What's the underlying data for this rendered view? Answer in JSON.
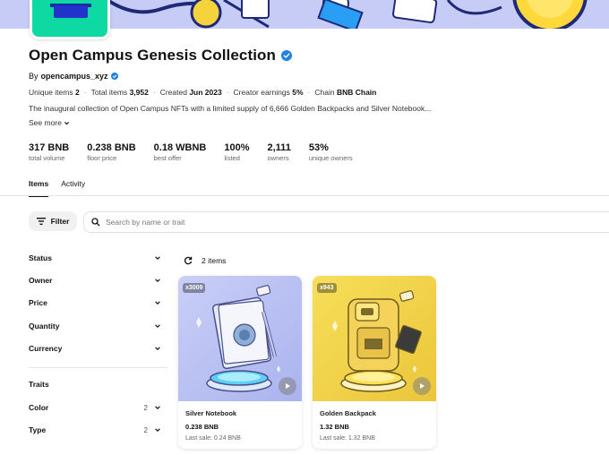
{
  "collection": {
    "title": "Open Campus Genesis Collection",
    "by_prefix": "By",
    "creator": "opencampus_xyz",
    "meta": [
      {
        "label": "Unique items",
        "value": "2"
      },
      {
        "label": "Total items",
        "value": "3,952"
      },
      {
        "label": "Created",
        "value": "Jun 2023"
      },
      {
        "label": "Creator earnings",
        "value": "5%"
      },
      {
        "label": "Chain",
        "value": "BNB Chain"
      }
    ],
    "description": "The inaugural collection of Open Campus NFTs with a limited supply of 6,666 Golden Backpacks and Silver Notebook...",
    "see_more": "See more"
  },
  "stats": [
    {
      "value": "317 BNB",
      "label": "total volume"
    },
    {
      "value": "0.238 BNB",
      "label": "floor price"
    },
    {
      "value": "0.18 WBNB",
      "label": "best offer"
    },
    {
      "value": "100%",
      "label": "listed"
    },
    {
      "value": "2,111",
      "label": "owners"
    },
    {
      "value": "53%",
      "label": "unique owners"
    }
  ],
  "tabs": [
    {
      "label": "Items",
      "active": true
    },
    {
      "label": "Activity",
      "active": false
    }
  ],
  "filter": {
    "label": "Filter"
  },
  "search": {
    "placeholder": "Search by name or trait"
  },
  "sidebar": {
    "facets": [
      {
        "label": "Status",
        "count": ""
      },
      {
        "label": "Owner",
        "count": ""
      },
      {
        "label": "Price",
        "count": ""
      },
      {
        "label": "Quantity",
        "count": ""
      },
      {
        "label": "Currency",
        "count": ""
      }
    ],
    "traits_heading": "Traits",
    "traits": [
      {
        "label": "Color",
        "count": "2"
      },
      {
        "label": "Type",
        "count": "2"
      }
    ]
  },
  "items_head": {
    "count_label": "2 items"
  },
  "items": [
    {
      "badge": "x3009",
      "name": "Silver Notebook",
      "price": "0.238 BNB",
      "last_sale": "Last sale: 0.24 BNB",
      "bg": "#b9c0f2"
    },
    {
      "badge": "x943",
      "name": "Golden Backpack",
      "price": "1.32 BNB",
      "last_sale": "Last sale: 1.32 BNB",
      "bg": "#f0d44a"
    }
  ],
  "colors": {
    "accent": "#2081e2",
    "verified": "#2081e2",
    "avatar": "#0fd9a3"
  }
}
